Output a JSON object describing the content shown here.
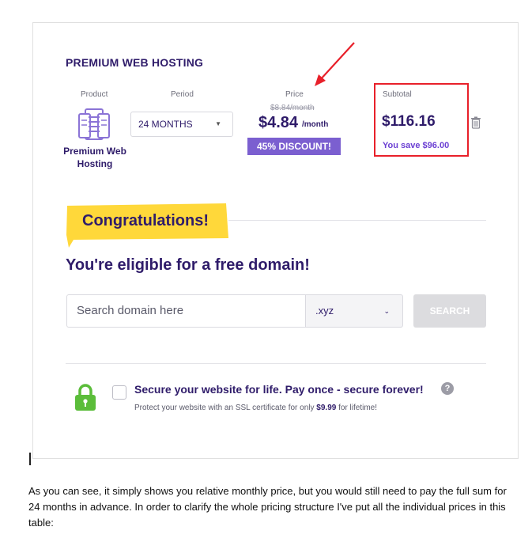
{
  "card": {
    "title": "PREMIUM WEB HOSTING",
    "columns": {
      "product": "Product",
      "period": "Period",
      "price": "Price",
      "subtotal": "Subtotal"
    },
    "product_name": "Premium Web Hosting",
    "product_icon": "server-rack-icon",
    "period_value": "24 MONTHS",
    "old_price": "$8.84/month",
    "new_price": "$4.84",
    "per_month": "/month",
    "discount": "45% DISCOUNT!",
    "subtotal_value": "$116.16",
    "you_save": "You save $96.00",
    "delete_icon": "trash-icon",
    "accent_color": "#7b5fd0",
    "highlight_color": "#e8202a"
  },
  "domain": {
    "banner": "Congratulations!",
    "banner_color": "#ffd83a",
    "heading": "You're eligible for a free domain!",
    "search_placeholder": "Search domain here",
    "tld_value": ".xyz",
    "search_button": "SEARCH"
  },
  "ssl": {
    "title": "Secure your website for life. Pay once - secure forever!",
    "desc_prefix": "Protect your website with an SSL certificate for only ",
    "desc_price": "$9.99",
    "desc_suffix": " for lifetime!",
    "lock_icon": "padlock-icon",
    "help_icon": "question-circle-icon",
    "lock_color": "#5bbd3a"
  },
  "article": {
    "paragraph": "As you can see, it simply shows you relative monthly price, but you would still need to pay the full sum for 24 months in advance. In order to clarify the whole pricing structure I've put all the individual prices in this table:"
  }
}
